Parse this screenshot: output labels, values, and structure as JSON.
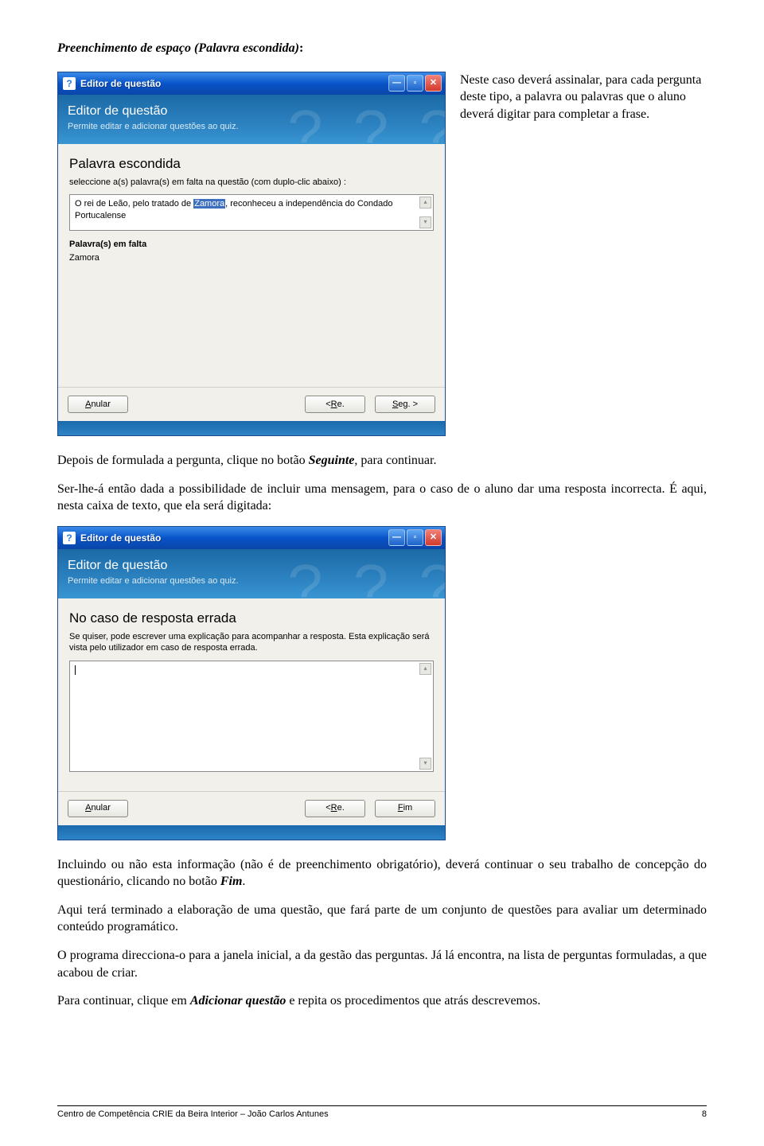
{
  "doc": {
    "section_title_bold_italic": "Preenchimento de espaço (Palavra escondida)",
    "section_title_colon": ":",
    "intro_right": "Neste caso deverá assinalar, para cada pergunta deste tipo, a palavra ou palavras que o aluno deverá digitar para completar a frase.",
    "after_win1_p1_a": "Depois de formulada a pergunta, clique no botão ",
    "after_win1_p1_seg": "Seguinte",
    "after_win1_p1_b": ", para continuar.",
    "after_win1_p2": "Ser-lhe-á então dada a possibilidade de incluir uma mensagem, para o caso de o aluno dar uma resposta incorrecta. É aqui, nesta caixa de texto, que ela será digitada:",
    "after_win2_p1_a": "Incluindo ou não esta informação (não é de preenchimento obrigatório), deverá continuar o seu trabalho de concepção do questionário, clicando no botão ",
    "after_win2_p1_fim": "Fim",
    "after_win2_p1_b": ".",
    "after_win2_p2": "Aqui terá terminado a elaboração de uma questão, que fará parte de um conjunto de questões para avaliar um determinado conteúdo programático.",
    "after_win2_p3": "O programa direcciona-o para a janela inicial, a da gestão das perguntas. Já lá encontra, na lista de perguntas formuladas, a que acabou de criar.",
    "after_win2_p4_a": "Para continuar, clique em ",
    "after_win2_p4_add": "Adicionar questão",
    "after_win2_p4_b": " e repita os procedimentos que atrás descrevemos.",
    "footer_left": "Centro de Competência CRIE da Beira Interior – João Carlos Antunes",
    "footer_right": "8"
  },
  "win1": {
    "title": "Editor de questão",
    "banner_title": "Editor de questão",
    "banner_sub": "Permite editar e adicionar questões ao quiz.",
    "h3": "Palavra escondida",
    "instr": "seleccione a(s) palavra(s) em falta na questão (com duplo-clic abaixo) :",
    "text_pre": "O rei de Leão, pelo tratado de ",
    "text_hl": "Zamora",
    "text_post": ", reconheceu a independência do Condado Portucalense",
    "label2": "Palavra(s) em falta",
    "value2": "Zamora",
    "btn_anular_u": "A",
    "btn_anular_rest": "nular",
    "btn_re": "< Re.",
    "btn_re_u": "R",
    "btn_seg": "Seg. >",
    "btn_seg_u": "S"
  },
  "win2": {
    "title": "Editor de questão",
    "banner_title": "Editor de questão",
    "banner_sub": "Permite editar e adicionar questões ao quiz.",
    "h3": "No caso de resposta errada",
    "instr": "Se quiser, pode escrever uma explicação para acompanhar a resposta. Esta explicação será vista pelo utilizador em caso de resposta errada.",
    "btn_anular_u": "A",
    "btn_anular_rest": "nular",
    "btn_re": "< Re.",
    "btn_fim_u": "F",
    "btn_fim_rest": "im"
  }
}
